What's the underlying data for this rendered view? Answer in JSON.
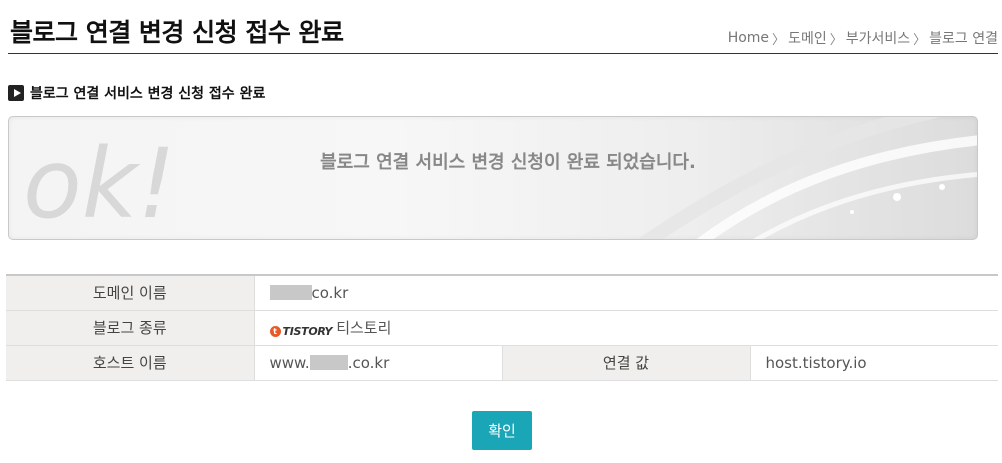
{
  "header": {
    "title": "블로그 연결 변경 신청 접수 완료",
    "breadcrumb": [
      "Home",
      "도메인",
      "부가서비스",
      "블로그 연결"
    ]
  },
  "section": {
    "title": "블로그 연결 서비스 변경 신청 접수 완료"
  },
  "banner": {
    "mark": "ok!",
    "message": "블로그 연결 서비스 변경 신청이 완료 되었습니다."
  },
  "info": {
    "domain_label": "도메인 이름",
    "domain_suffix": "co.kr",
    "blog_type_label": "블로그 종류",
    "blog_logo_text": "TISTORY",
    "blog_type_value": "티스토리",
    "host_label": "호스트 이름",
    "host_prefix": "www.",
    "host_suffix": ".co.kr",
    "link_label": "연결 값",
    "link_value": "host.tistory.io"
  },
  "actions": {
    "confirm_label": "확인"
  },
  "colors": {
    "accent": "#1aa6b7",
    "label_bg": "#f1efed",
    "tistory_orange": "#e85a28"
  },
  "icons": {
    "section_bullet": "play-icon",
    "breadcrumb_separator": "chevron-right-icon"
  }
}
